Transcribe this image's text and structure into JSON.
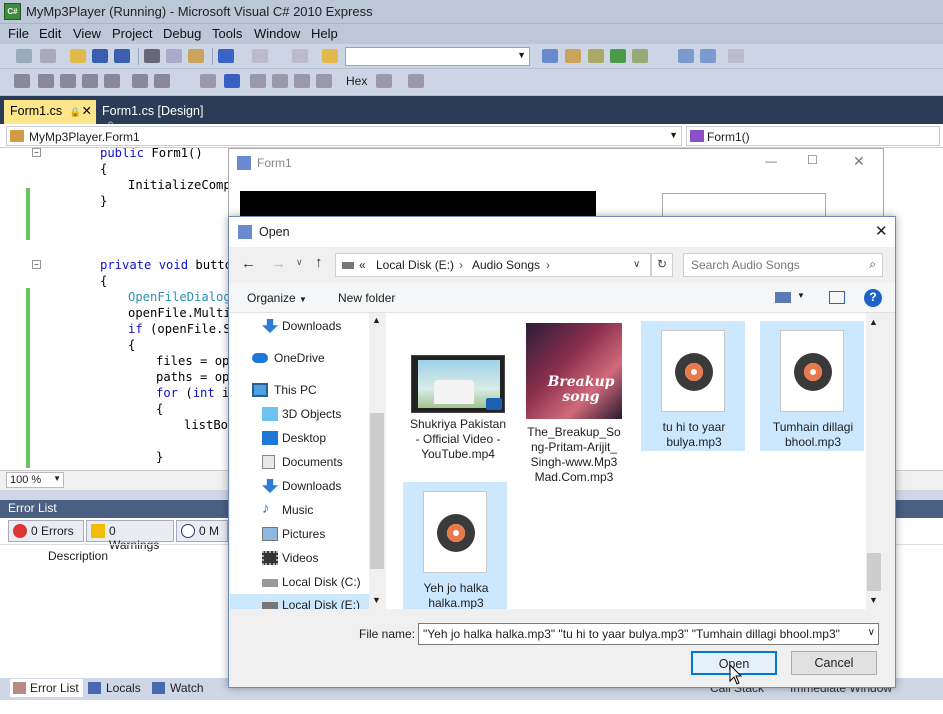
{
  "ide": {
    "title": "MyMp3Player (Running) - Microsoft Visual C# 2010 Express",
    "menu": [
      "File",
      "Edit",
      "View",
      "Project",
      "Debug",
      "Tools",
      "Window",
      "Help"
    ],
    "toolbar_hex": "Hex",
    "doc_tabs": [
      {
        "label": "Form1.cs",
        "active": true
      },
      {
        "label": "Form1.cs [Design]",
        "active": false
      }
    ],
    "nav_left": "MyMp3Player.Form1",
    "nav_right": "Form1()",
    "code": [
      "public Form1()",
      "{",
      "InitializeCompo",
      "}",
      "private void button",
      "{",
      "OpenFileDialog",
      "openFile.Multis",
      "if (openFile.Sh",
      "{",
      "files = ope",
      "paths = ope",
      "for (int i",
      "{",
      "listBox",
      "}"
    ],
    "zoom": "100 %",
    "error_list": {
      "title": "Error List",
      "errors": "0 Errors",
      "warnings": "0 Warnings",
      "messages": "0 M",
      "column": "Description"
    },
    "bottom_tabs": [
      "Error List",
      "Locals",
      "Watch"
    ],
    "bottom_right_tabs": [
      "Call Stack",
      "Immediate Window"
    ]
  },
  "form1": {
    "title": "Form1"
  },
  "dialog": {
    "title": "Open",
    "breadcrumb": [
      "«",
      "Local Disk (E:)",
      "Audio Songs"
    ],
    "search_placeholder": "Search Audio Songs",
    "organize": "Organize",
    "new_folder": "New folder",
    "nav_items": [
      {
        "label": "Downloads",
        "icon": "downloads-icon"
      },
      {
        "label": "OneDrive",
        "icon": "onedrive-icon"
      },
      {
        "label": "This PC",
        "icon": "pc-icon"
      },
      {
        "label": "3D Objects",
        "icon": "3d-objects-icon"
      },
      {
        "label": "Desktop",
        "icon": "desktop-icon"
      },
      {
        "label": "Documents",
        "icon": "documents-icon"
      },
      {
        "label": "Downloads",
        "icon": "downloads-icon"
      },
      {
        "label": "Music",
        "icon": "music-icon"
      },
      {
        "label": "Pictures",
        "icon": "pictures-icon"
      },
      {
        "label": "Videos",
        "icon": "videos-icon"
      },
      {
        "label": "Local Disk (C:)",
        "icon": "drive-icon"
      },
      {
        "label": "Local Disk (E:)",
        "icon": "drive-icon"
      }
    ],
    "files": [
      {
        "name": "Shukriya Pakistan - Official Video - YouTube.mp4",
        "lines": [
          "Shukriya Pakistan",
          "- Official Video -",
          "YouTube.mp4"
        ],
        "selected": false
      },
      {
        "name": "The_Breakup_Song-Pritam-Arijit_Singh-www.Mp3Mad.Com.mp3",
        "lines": [
          "The_Breakup_So",
          "ng-Pritam-Arijit_",
          "Singh-www.Mp3",
          "Mad.Com.mp3"
        ],
        "selected": false
      },
      {
        "name": "tu hi to yaar bulya.mp3",
        "lines": [
          "tu hi to yaar",
          "bulya.mp3"
        ],
        "selected": true
      },
      {
        "name": "Tumhain dillagi bhool.mp3",
        "lines": [
          "Tumhain dillagi",
          "bhool.mp3"
        ],
        "selected": true
      },
      {
        "name": "Yeh jo halka halka.mp3",
        "lines": [
          "Yeh jo halka",
          "halka.mp3"
        ],
        "selected": true
      }
    ],
    "album_art_text": "Breakup song",
    "file_name_label": "File name:",
    "file_name_value": "\"Yeh jo halka halka.mp3\" \"tu hi to yaar bulya.mp3\" \"Tumhain dillagi bhool.mp3\"",
    "open_button": "Open",
    "cancel_button": "Cancel"
  }
}
